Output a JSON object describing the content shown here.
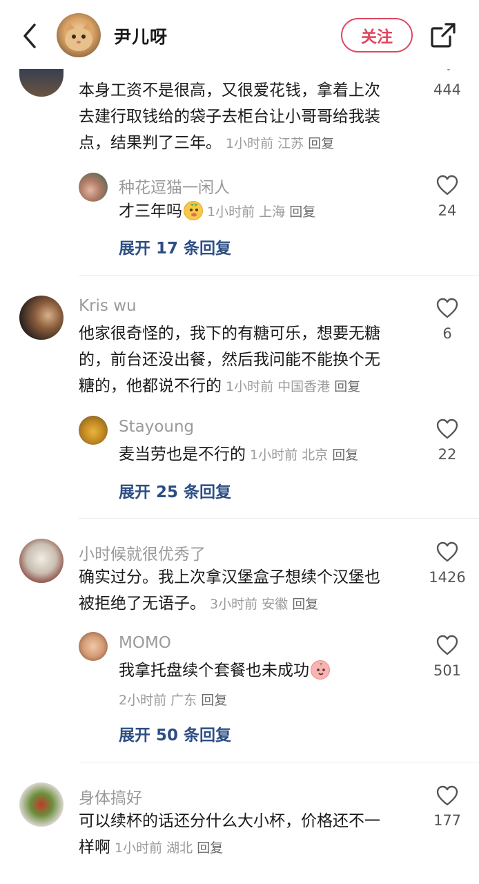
{
  "header": {
    "name": "尹儿呀",
    "follow_label": "关注"
  },
  "comments": [
    {
      "text": "本身工资不是很高，又很爱花钱，拿着上次去建行取钱给的袋子去柜台让小哥哥给我装点，结果判了三年。",
      "lines": [
        "本身工资不是很高，又很爱花钱，拿着上次",
        "去建行取钱给的袋子去柜台让小哥哥给我装",
        "点，结果判了三年。"
      ],
      "time": "1小时前",
      "location": "江苏",
      "reply_label": "回复",
      "likes": "444",
      "sub_reply": {
        "user": "种花逗猫一闲人",
        "text": "才三年吗",
        "time": "1小时前",
        "location": "上海",
        "reply_label": "回复",
        "likes": "24"
      },
      "expand_label": "展开 17 条回复"
    },
    {
      "user": "Kris wu",
      "lines": [
        "他家很奇怪的，我下的有糖可乐，想要无糖",
        "的，前台还没出餐，然后我问能不能换个无",
        "糖的，他都说不行的"
      ],
      "time": "1小时前",
      "location": "中国香港",
      "reply_label": "回复",
      "likes": "6",
      "sub_reply": {
        "user": "Stayoung",
        "text": "麦当劳也是不行的",
        "time": "1小时前",
        "location": "北京",
        "reply_label": "回复",
        "likes": "22"
      },
      "expand_label": "展开 25 条回复"
    },
    {
      "user": "小时候就很优秀了",
      "lines": [
        "确实过分。我上次拿汉堡盒子想续个汉堡也",
        "被拒绝了无语子。"
      ],
      "time": "3小时前",
      "location": "安徽",
      "reply_label": "回复",
      "likes": "1426",
      "sub_reply": {
        "user": "MOMO",
        "text": "我拿托盘续个套餐也未成功",
        "time": "2小时前",
        "location": "广东",
        "reply_label": "回复",
        "likes": "501"
      },
      "expand_label": "展开 50 条回复"
    },
    {
      "user": "身体搞好",
      "lines": [
        "可以续杯的话还分什么大小杯，价格还不一",
        "样啊"
      ],
      "time": "1小时前",
      "location": "湖北",
      "reply_label": "回复",
      "likes": "177"
    }
  ],
  "colors": {
    "accent": "#e0455c",
    "expand_link": "#2d4e84",
    "meta_gray": "#9a9a9a"
  },
  "icons": [
    "back-arrow-icon",
    "share-icon",
    "heart-outline-icon",
    "emoji-icon"
  ]
}
